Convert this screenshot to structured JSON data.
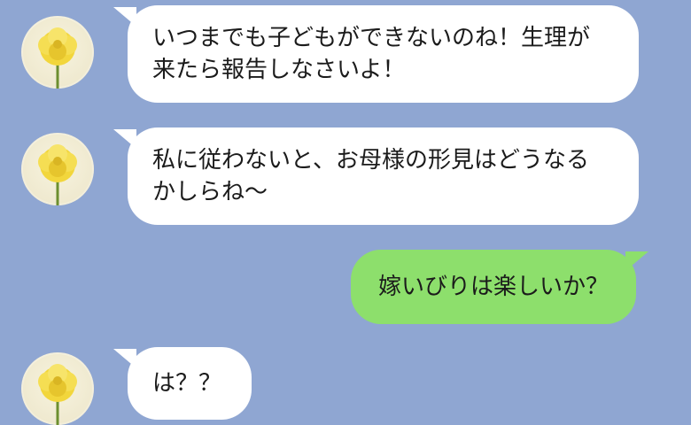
{
  "messages": [
    {
      "side": "left",
      "avatar_icon": "yellow-flower-icon",
      "text": "いつまでも子どもができないのね！生理が\n来たら報告しなさいよ！"
    },
    {
      "side": "left",
      "avatar_icon": "yellow-flower-icon",
      "text": "私に従わないと、お母様の形見はどうなる\nかしらね〜"
    },
    {
      "side": "right",
      "text": "嫁いびりは楽しいか？"
    },
    {
      "side": "left",
      "avatar_icon": "yellow-flower-icon",
      "text": "は？？"
    }
  ],
  "colors": {
    "background": "#8fa6d2",
    "incoming_bubble": "#ffffff",
    "outgoing_bubble": "#8ddf6c"
  }
}
